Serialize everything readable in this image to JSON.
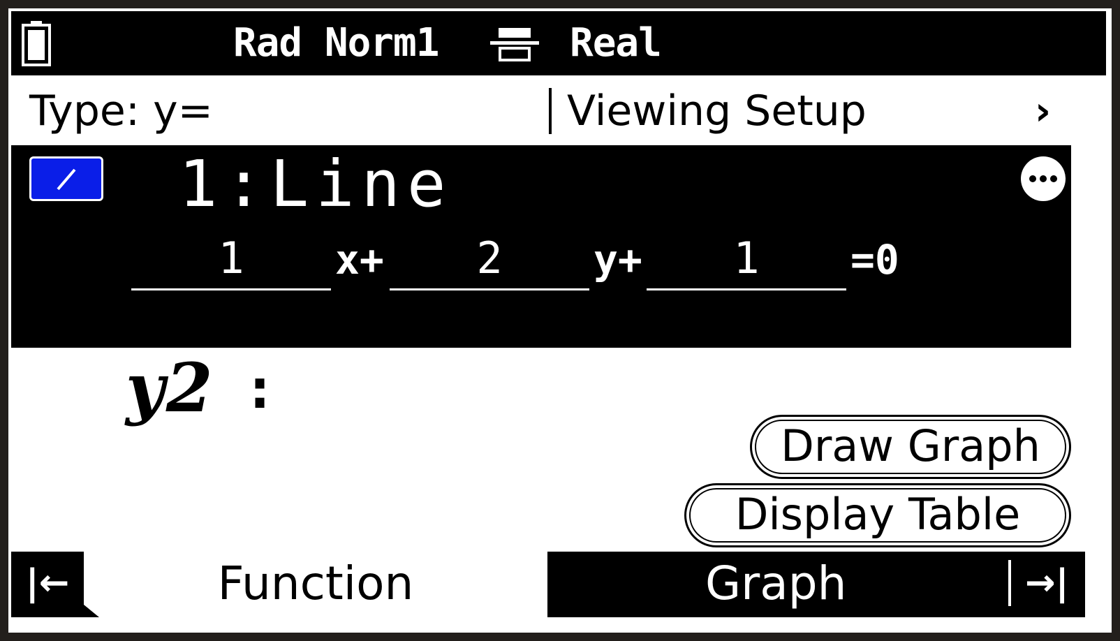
{
  "status_bar": {
    "battery_icon": "battery-icon",
    "mode": "Rad Norm1",
    "display_icon": "display-format-icon",
    "number_mode": "Real"
  },
  "type_row": {
    "type_label": "Type: y=",
    "viewing_setup": "Viewing Setup",
    "chevron": "›"
  },
  "function_1": {
    "checked": true,
    "title": "1:Line",
    "more_icon": "more-options-icon",
    "coef_x": "1",
    "op_x": "x+",
    "coef_y": "2",
    "op_y": "y+",
    "constant": "1",
    "equals": "=0"
  },
  "function_2": {
    "y_label": "y2",
    "colon": ":"
  },
  "buttons": {
    "draw_graph": "Draw Graph",
    "display_table": "Display Table"
  },
  "tabs": {
    "left_arrow": "|←",
    "function": "Function",
    "graph": "Graph",
    "right_arrow": "→|"
  }
}
